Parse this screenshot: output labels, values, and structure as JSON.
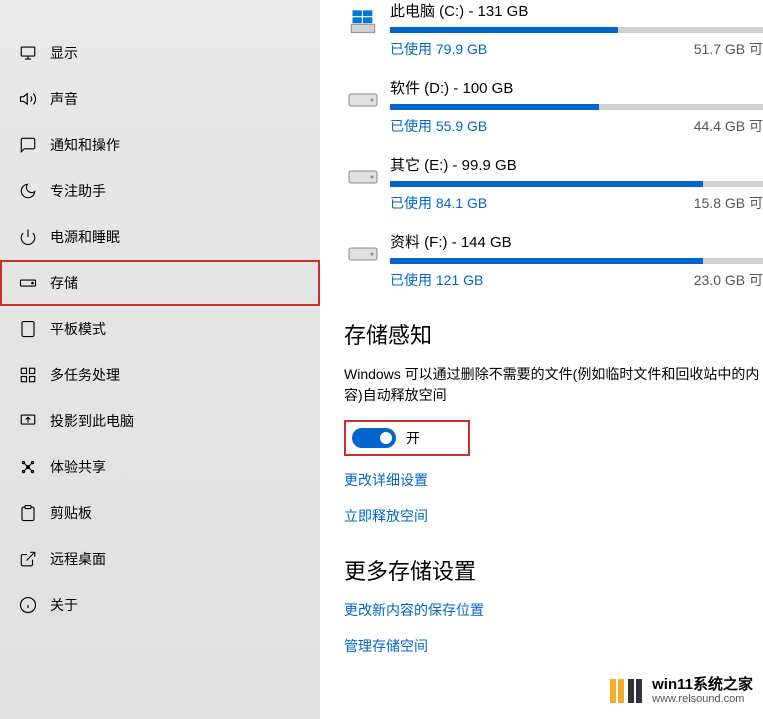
{
  "sidebar": {
    "items": [
      {
        "label": "显示"
      },
      {
        "label": "声音"
      },
      {
        "label": "通知和操作"
      },
      {
        "label": "专注助手"
      },
      {
        "label": "电源和睡眠"
      },
      {
        "label": "存储"
      },
      {
        "label": "平板模式"
      },
      {
        "label": "多任务处理"
      },
      {
        "label": "投影到此电脑"
      },
      {
        "label": "体验共享"
      },
      {
        "label": "剪贴板"
      },
      {
        "label": "远程桌面"
      },
      {
        "label": "关于"
      }
    ]
  },
  "drives": [
    {
      "title": "此电脑 (C:) - 131 GB",
      "used": "已使用 79.9 GB",
      "free": "51.7 GB 可",
      "percent": 61
    },
    {
      "title": "软件 (D:) - 100 GB",
      "used": "已使用 55.9 GB",
      "free": "44.4 GB 可",
      "percent": 56
    },
    {
      "title": "其它 (E:) - 99.9 GB",
      "used": "已使用 84.1 GB",
      "free": "15.8 GB 可",
      "percent": 84
    },
    {
      "title": "资料 (F:) - 144 GB",
      "used": "已使用 121 GB",
      "free": "23.0 GB 可",
      "percent": 84
    }
  ],
  "storageSense": {
    "title": "存储感知",
    "desc": "Windows 可以通过删除不需要的文件(例如临时文件和回收站中的内容)自动释放空间",
    "toggleLabel": "开",
    "link1": "更改详细设置",
    "link2": "立即释放空间"
  },
  "moreSettings": {
    "title": "更多存储设置",
    "link1": "更改新内容的保存位置",
    "link2": "管理存储空间"
  },
  "watermark": {
    "main": "win11系统之家",
    "sub": "www.relsound.com"
  }
}
